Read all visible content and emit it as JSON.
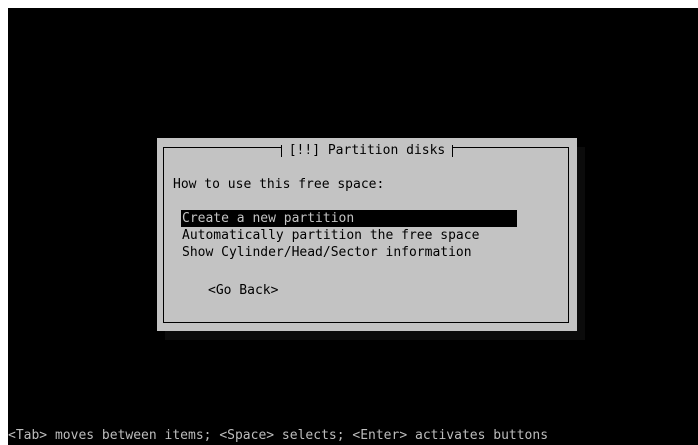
{
  "colors": {
    "screen_background": "#000000",
    "dialog_background": "#c3c3c3",
    "dialog_text": "#000000",
    "selected_background": "#000000",
    "selected_text": "#c3c3c3",
    "status_text": "#bdbdbd"
  },
  "dialog": {
    "title": "[!!] Partition disks",
    "prompt": "How to use this free space:",
    "options": [
      {
        "label": "Create a new partition",
        "selected": true
      },
      {
        "label": "Automatically partition the free space",
        "selected": false
      },
      {
        "label": "Show Cylinder/Head/Sector information",
        "selected": false
      }
    ],
    "go_back_label": "<Go Back>"
  },
  "status_bar": {
    "text": "<Tab> moves between items; <Space> selects; <Enter> activates buttons"
  }
}
